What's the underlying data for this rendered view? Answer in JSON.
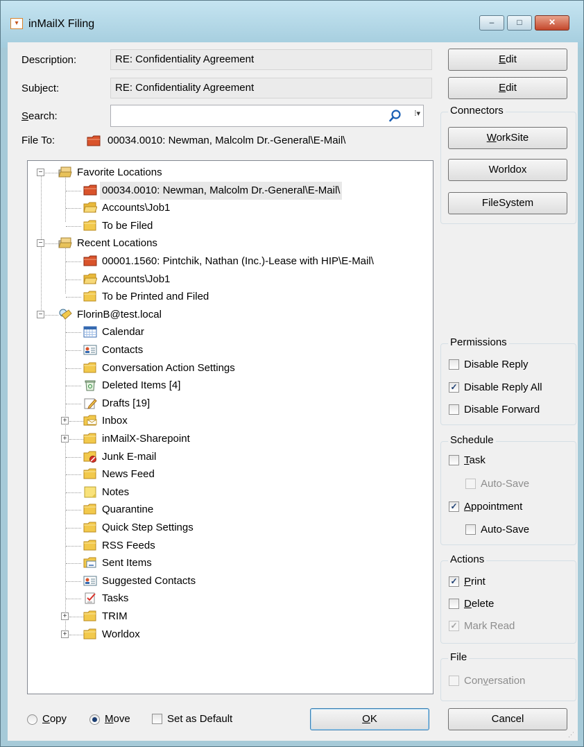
{
  "window": {
    "title": "inMailX Filing",
    "controls": {
      "min": "–",
      "max": "□",
      "close": "✕"
    },
    "app_icon": "filing-icon"
  },
  "form": {
    "description_label": "Description:",
    "description_value": "RE: Confidentiality Agreement",
    "subject_label": "Subject:",
    "subject_value": "RE: Confidentiality Agreement",
    "search_label_pre": "",
    "search_label_u": "S",
    "search_label_post": "earch:",
    "search_value": "",
    "file_to_label": "File To:",
    "file_to_value": "00034.0010: Newman, Malcolm Dr.-General\\E-Mail\\"
  },
  "buttons": {
    "edit_desc": {
      "u": "E",
      "rest": "dit"
    },
    "edit_subj": {
      "u": "E",
      "rest": "dit"
    },
    "ok": {
      "u": "O",
      "rest": "K"
    },
    "cancel": "Cancel"
  },
  "connectors": {
    "title": "Connectors",
    "worksite": {
      "u": "W",
      "rest": "orkSite"
    },
    "worldox": "Worldox",
    "filesystem": "FileSystem"
  },
  "tree": [
    {
      "label": "Favorite Locations",
      "icon": "locations-icon",
      "level": 0,
      "expander": "−"
    },
    {
      "label": "00034.0010: Newman, Malcolm Dr.-General\\E-Mail\\",
      "icon": "matter-folder-icon",
      "level": 1,
      "selected": true
    },
    {
      "label": "Accounts\\Job1",
      "icon": "folder-open-icon",
      "level": 1
    },
    {
      "label": "To be Filed",
      "icon": "folder-icon",
      "level": 1
    },
    {
      "label": "Recent Locations",
      "icon": "locations-icon",
      "level": 0,
      "expander": "−"
    },
    {
      "label": "00001.1560: Pintchik, Nathan (Inc.)-Lease with HIP\\E-Mail\\",
      "icon": "matter-folder-icon",
      "level": 1
    },
    {
      "label": "Accounts\\Job1",
      "icon": "folder-open-icon",
      "level": 1
    },
    {
      "label": "To be Printed and Filed",
      "icon": "folder-icon",
      "level": 1
    },
    {
      "label": "FlorinB@test.local",
      "icon": "mailbox-icon",
      "level": 0,
      "expander": "−"
    },
    {
      "label": "Calendar",
      "icon": "calendar-icon",
      "level": 1
    },
    {
      "label": "Contacts",
      "icon": "contacts-icon",
      "level": 1
    },
    {
      "label": "Conversation Action Settings",
      "icon": "folder-icon",
      "level": 1
    },
    {
      "label": "Deleted Items [4]",
      "icon": "deleted-items-icon",
      "level": 1
    },
    {
      "label": "Drafts [19]",
      "icon": "drafts-icon",
      "level": 1
    },
    {
      "label": "Inbox",
      "icon": "inbox-icon",
      "level": 1,
      "expander": "+"
    },
    {
      "label": "inMailX-Sharepoint",
      "icon": "folder-icon",
      "level": 1,
      "expander": "+"
    },
    {
      "label": "Junk E-mail",
      "icon": "junk-icon",
      "level": 1
    },
    {
      "label": "News Feed",
      "icon": "folder-icon",
      "level": 1
    },
    {
      "label": "Notes",
      "icon": "notes-icon",
      "level": 1
    },
    {
      "label": "Quarantine",
      "icon": "folder-icon",
      "level": 1
    },
    {
      "label": "Quick Step Settings",
      "icon": "folder-icon",
      "level": 1
    },
    {
      "label": "RSS Feeds",
      "icon": "folder-icon",
      "level": 1
    },
    {
      "label": "Sent Items",
      "icon": "sent-items-icon",
      "level": 1
    },
    {
      "label": "Suggested Contacts",
      "icon": "contacts-icon",
      "level": 1
    },
    {
      "label": "Tasks",
      "icon": "tasks-icon",
      "level": 1
    },
    {
      "label": "TRIM",
      "icon": "folder-icon",
      "level": 1,
      "expander": "+"
    },
    {
      "label": "Worldox",
      "icon": "folder-icon",
      "level": 1,
      "expander": "+"
    }
  ],
  "permissions": {
    "title": "Permissions",
    "disable_reply": {
      "label": "Disable Reply",
      "checked": false
    },
    "disable_reply_all": {
      "label": "Disable Reply All",
      "checked": true
    },
    "disable_forward": {
      "label": "Disable Forward",
      "checked": false
    }
  },
  "schedule": {
    "title": "Schedule",
    "task": {
      "u": "T",
      "rest": "ask",
      "checked": false
    },
    "task_autosave": {
      "label": "Auto-Save",
      "checked": false,
      "disabled": true
    },
    "appointment": {
      "u": "A",
      "rest": "ppointment",
      "checked": true
    },
    "appointment_autosave": {
      "label": "Auto-Save",
      "checked": false
    }
  },
  "actions": {
    "title": "Actions",
    "print": {
      "u": "P",
      "rest": "rint",
      "checked": true
    },
    "delete": {
      "u": "D",
      "rest": "elete",
      "checked": false
    },
    "mark_read": {
      "label": "Mark Read",
      "checked": true,
      "disabled": true
    }
  },
  "file_group": {
    "title": "File",
    "conversation": {
      "pre": "Con",
      "u": "v",
      "rest": "ersation",
      "checked": false,
      "disabled": true
    }
  },
  "bottom": {
    "copy": {
      "u": "C",
      "rest": "opy",
      "selected": false
    },
    "move": {
      "u": "M",
      "rest": "ove",
      "selected": true
    },
    "set_default": {
      "label": "Set as Default",
      "checked": false
    }
  },
  "colors": {
    "accent": "#1c3e72",
    "title_gradient_top": "#c5e4f1",
    "close_button": "#c4472b",
    "selection": "#e8e8e8"
  }
}
